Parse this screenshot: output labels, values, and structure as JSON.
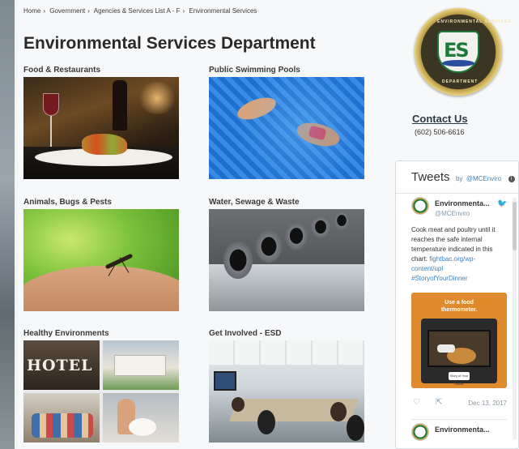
{
  "breadcrumb": [
    {
      "label": "Home"
    },
    {
      "label": "Government"
    },
    {
      "label": "Agencies & Services List A - F"
    },
    {
      "label": "Environmental Services"
    }
  ],
  "breadcrumb_sep": "›",
  "page_title": "Environmental Services Department",
  "cards": [
    {
      "label": "Food & Restaurants"
    },
    {
      "label": "Public Swimming Pools"
    },
    {
      "label": "Animals, Bugs & Pests"
    },
    {
      "label": "Water, Sewage & Waste"
    },
    {
      "label": "Healthy Environments",
      "image_text": "HOTEL"
    },
    {
      "label": "Get Involved - ESD"
    }
  ],
  "logo": {
    "letters": "ES",
    "ring_top": "ENVIRONMENTAL SERVICES",
    "ring_bottom": "DEPARTMENT"
  },
  "contact": {
    "link_label": "Contact Us",
    "phone": "(602) 506-6616"
  },
  "tweets": {
    "title": "Tweets",
    "by": "by",
    "handle": "@MCEnviro",
    "info": "i",
    "items": [
      {
        "name": "Environmenta...",
        "handle": "@MCEnviro",
        "text": "Cook meat and poultry until it reaches the safe internal temperature indicated in this chart:",
        "link": "fightbac.org/wp-content/upl",
        "hashtag": "#StoryofYourDinner",
        "media_caption_1": "Use a food",
        "media_caption_2": "thermometer.",
        "media_badge": "Story of Your Dinner",
        "date": "Dec 13, 2017"
      },
      {
        "name": "Environmenta..."
      }
    ]
  },
  "icons": {
    "bird": "twitter-bird-icon",
    "heart": "heart-icon",
    "share": "share-icon"
  },
  "colors": {
    "logo_green": "#1f7a3a",
    "logo_gold": "#c9a84f",
    "link_blue": "#3a83c2"
  }
}
